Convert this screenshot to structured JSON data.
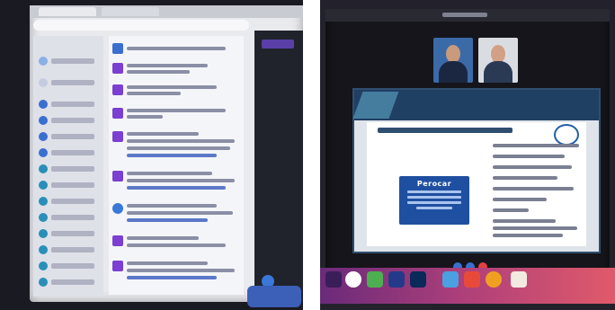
{
  "right_photo": {
    "slide_card_title": "Perocar"
  }
}
